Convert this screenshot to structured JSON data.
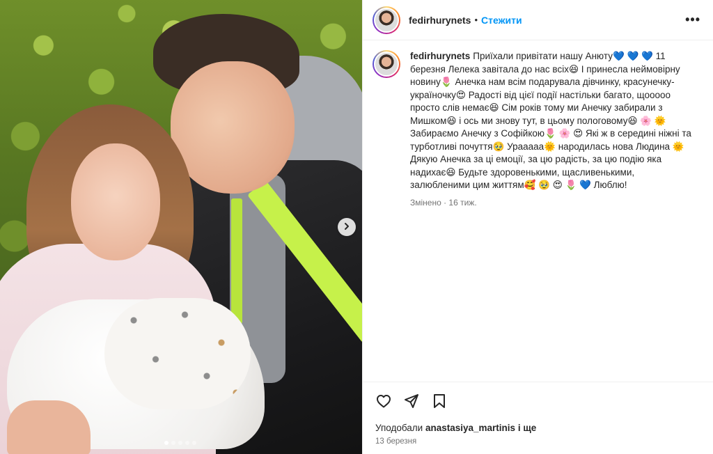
{
  "post": {
    "username": "fedirhurynets",
    "separator": "•",
    "follow_label": "Стежити",
    "more_label": "•••",
    "caption": "Приїхали привітати нашу Анюту💙 💙 💙 11 березня Лелека завітала до нас всіх😆 І принесла неймовірну новину🌷 Анечка нам всім подарувала дівчинку, красунечку-україночку😍 Радості від цієї події настільки багато, щоoooo просто слів немає😆 Сім років тому ми Анечку забирали з Мишком😆 і ось ми знову тут, в цьому пологовому😆 🌸 🌞 Забираємо Анечку з Софійкою🌷 🌸 😍 Які ж в середині ніжні та турботливі почуття🥹 Урааааа🌞 народилась нова Людина 🌞 Дякую Анечка за ці емоції, за цю радість, за цю подію яка надихає😆 Будьте здоровенькими, щасливенькими, залюбленими цим життям🥰 🥹 😍 🌷 💙 Люблю!",
    "meta": "Змінено · 16 тиж.",
    "likes_prefix": "Уподобали ",
    "likes_user": "anastasiya_martinis",
    "likes_suffix": " і ще",
    "date": "13 березня"
  },
  "media": {
    "carousel_next_icon": "chevron-right-icon",
    "slide_count": 5,
    "active_slide": 1
  },
  "actions": {
    "like_icon": "heart-icon",
    "share_icon": "paper-plane-icon",
    "save_icon": "bookmark-icon"
  },
  "colors": {
    "follow": "#0095f6",
    "strap": "#c6f14a",
    "text_secondary": "#737373"
  }
}
